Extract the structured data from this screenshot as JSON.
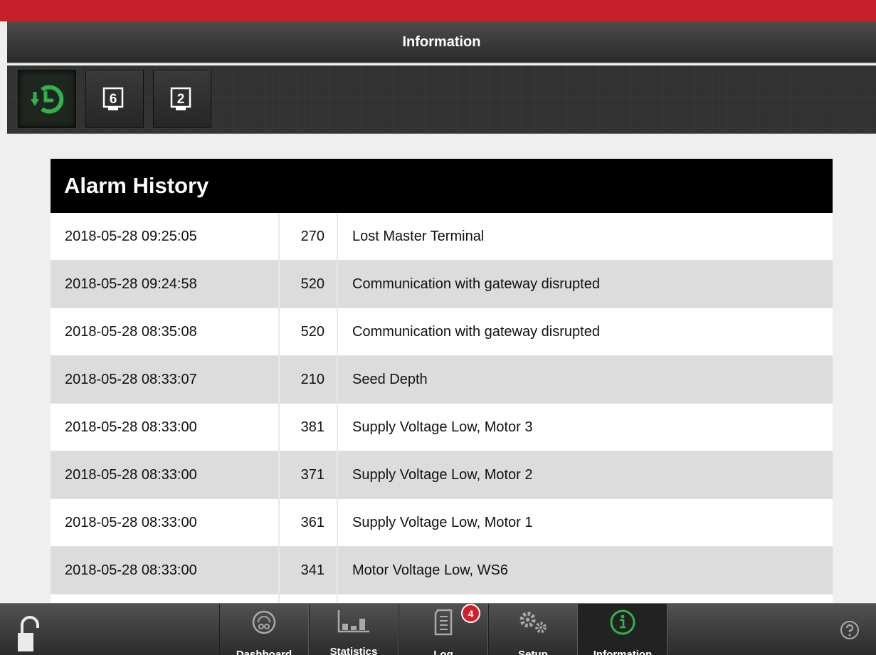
{
  "header": {
    "title": "Information"
  },
  "toolbar": {
    "buttons": [
      {
        "icon": "alarm-history-icon",
        "active": true
      },
      {
        "icon": "terminal-6-icon",
        "number": "6",
        "active": false
      },
      {
        "icon": "terminal-2-icon",
        "number": "2",
        "active": false
      }
    ]
  },
  "alarm_history": {
    "title": "Alarm History",
    "rows": [
      {
        "datetime": "2018-05-28 09:25:05",
        "code": "270",
        "description": "Lost Master Terminal"
      },
      {
        "datetime": "2018-05-28 09:24:58",
        "code": "520",
        "description": "Communication with gateway disrupted"
      },
      {
        "datetime": "2018-05-28 08:35:08",
        "code": "520",
        "description": "Communication with gateway disrupted"
      },
      {
        "datetime": "2018-05-28 08:33:07",
        "code": "210",
        "description": "Seed Depth"
      },
      {
        "datetime": "2018-05-28 08:33:00",
        "code": "381",
        "description": "Supply Voltage Low, Motor 3"
      },
      {
        "datetime": "2018-05-28 08:33:00",
        "code": "371",
        "description": "Supply Voltage Low, Motor 2"
      },
      {
        "datetime": "2018-05-28 08:33:00",
        "code": "361",
        "description": "Supply Voltage Low, Motor 1"
      },
      {
        "datetime": "2018-05-28 08:33:00",
        "code": "341",
        "description": "Motor Voltage Low, WS6"
      }
    ]
  },
  "bottom_nav": {
    "tabs": [
      {
        "label": "Dashboard",
        "icon": "dashboard-gauge-icon"
      },
      {
        "label": "Statistics",
        "icon": "statistics-bars-icon"
      },
      {
        "label": "Log",
        "icon": "log-document-icon",
        "badge": "4"
      },
      {
        "label": "Setup",
        "icon": "setup-gears-icon"
      },
      {
        "label": "Information",
        "icon": "information-icon",
        "active": true
      }
    ],
    "lock_icon": "unlock-icon",
    "help_icon": "help-icon"
  },
  "colors": {
    "accent_red": "#c8202a",
    "active_green": "#2fb34a",
    "badge_red": "#d1202a"
  }
}
